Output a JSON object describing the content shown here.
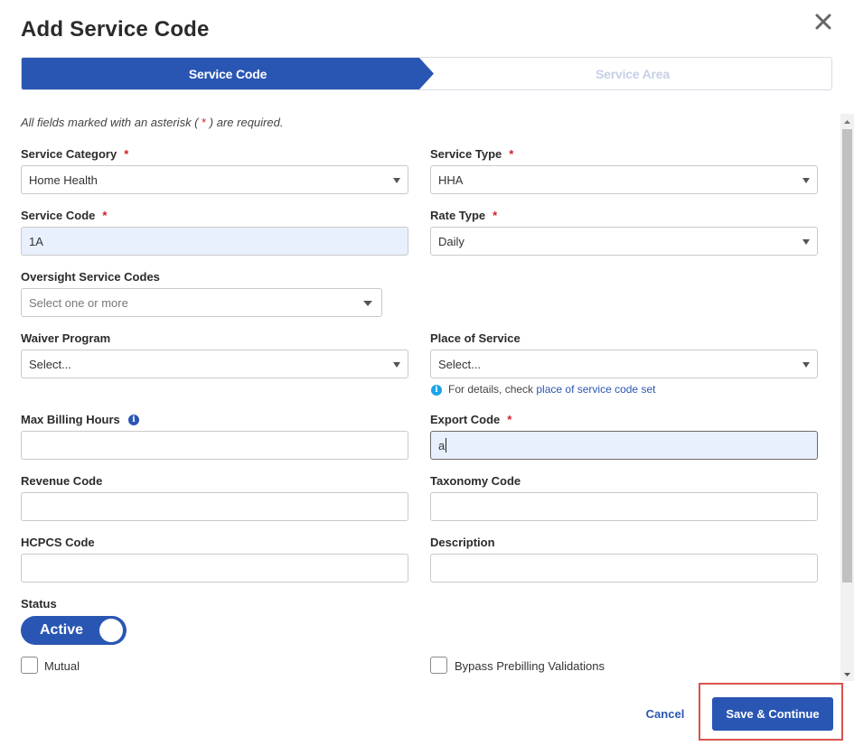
{
  "dialog": {
    "title": "Add Service Code"
  },
  "stepper": {
    "steps": [
      "Service Code",
      "Service Area"
    ]
  },
  "form": {
    "required_note": {
      "prefix": "All fields marked with an asterisk ( ",
      "star": "*",
      "suffix": " ) are required."
    },
    "required_marker": "*",
    "service_category": {
      "label": "Service Category",
      "value": "Home Health"
    },
    "service_type": {
      "label": "Service Type",
      "value": "HHA"
    },
    "service_code": {
      "label": "Service Code",
      "value": "1A"
    },
    "rate_type": {
      "label": "Rate Type",
      "value": "Daily"
    },
    "oversight_service_codes": {
      "label": "Oversight Service Codes",
      "placeholder": "Select one or more"
    },
    "waiver_program": {
      "label": "Waiver Program",
      "value": "Select..."
    },
    "place_of_service": {
      "label": "Place of Service",
      "value": "Select...",
      "hint": "For details, check ",
      "hint_link": "place of service code set"
    },
    "max_billing_hours": {
      "label": "Max Billing Hours",
      "value": ""
    },
    "export_code": {
      "label": "Export Code",
      "value": "a"
    },
    "revenue_code": {
      "label": "Revenue Code",
      "value": ""
    },
    "taxonomy_code": {
      "label": "Taxonomy Code",
      "value": ""
    },
    "hcpcs_code": {
      "label": "HCPCS Code",
      "value": ""
    },
    "description": {
      "label": "Description",
      "value": ""
    },
    "status": {
      "label": "Status",
      "toggle_label": "Active",
      "enabled": true
    },
    "mutual": {
      "label": "Mutual",
      "checked": false
    },
    "bypass": {
      "label": "Bypass Prebilling Validations",
      "checked": false
    }
  },
  "footer": {
    "cancel_label": "Cancel",
    "save_label": "Save & Continue"
  },
  "colors": {
    "primary": "#2a56b3",
    "required": "#d0202a",
    "highlight": "#d9534f"
  }
}
